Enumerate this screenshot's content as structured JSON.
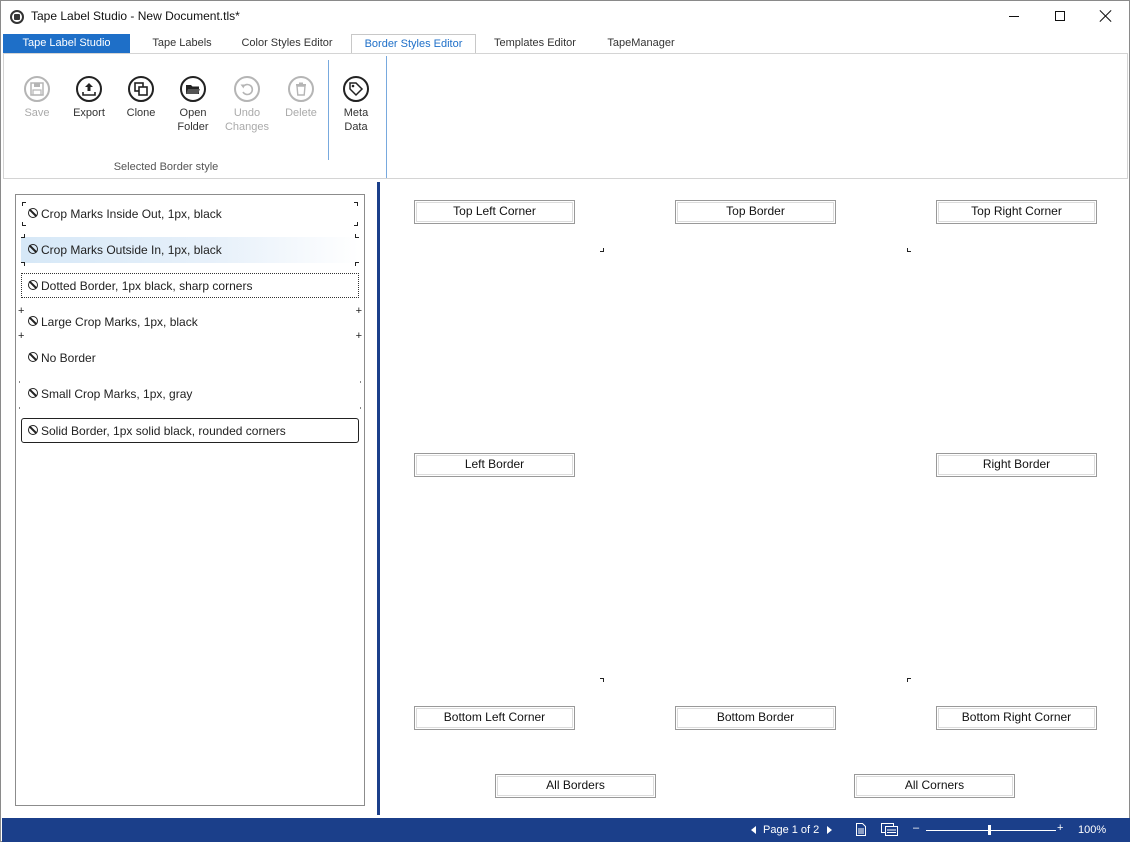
{
  "window": {
    "title": "Tape Label Studio - New Document.tls*"
  },
  "tabs": [
    {
      "label": "Tape Label Studio"
    },
    {
      "label": "Tape Labels"
    },
    {
      "label": "Color Styles Editor"
    },
    {
      "label": "Border Styles Editor"
    },
    {
      "label": "Templates Editor"
    },
    {
      "label": "TapeManager"
    }
  ],
  "ribbon": {
    "save": "Save",
    "export": "Export",
    "clone": "Clone",
    "open_folder_1": "Open",
    "open_folder_2": "Folder",
    "undo_1": "Undo",
    "undo_2": "Changes",
    "delete": "Delete",
    "meta_1": "Meta",
    "meta_2": "Data",
    "group_label": "Selected Border style"
  },
  "border_styles": [
    {
      "label": "Crop Marks Inside Out, 1px, black"
    },
    {
      "label": "Crop Marks Outside In, 1px, black"
    },
    {
      "label": "Dotted Border, 1px black, sharp corners"
    },
    {
      "label": "Large Crop Marks, 1px, black"
    },
    {
      "label": "No Border"
    },
    {
      "label": "Small Crop Marks, 1px, gray"
    },
    {
      "label": "Solid Border, 1px solid black, rounded corners"
    }
  ],
  "editor": {
    "top_left": "Top Left Corner",
    "top": "Top Border",
    "top_right": "Top Right Corner",
    "left": "Left Border",
    "right": "Right Border",
    "bottom_left": "Bottom Left Corner",
    "bottom": "Bottom Border",
    "bottom_right": "Bottom Right Corner",
    "all_borders": "All Borders",
    "all_corners": "All Corners"
  },
  "status": {
    "page": "Page 1 of 2",
    "zoom_minus": "–",
    "zoom_plus": "+",
    "zoom": "100%"
  },
  "colors": {
    "accent": "#1e6fc8",
    "statusbar": "#1b3f8a"
  }
}
